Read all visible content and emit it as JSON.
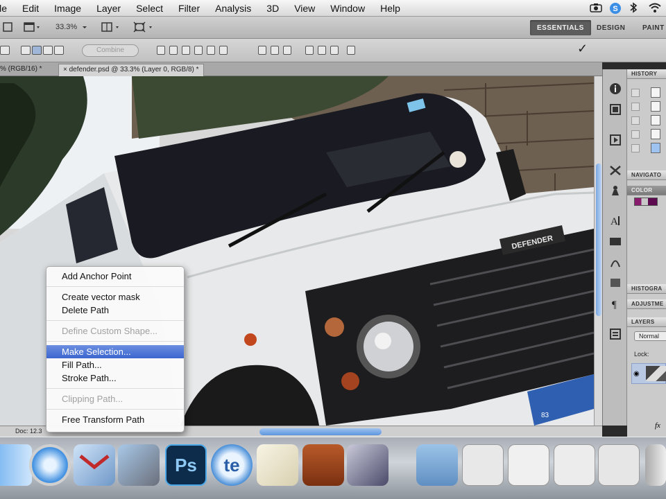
{
  "menubar": {
    "items": [
      "ile",
      "Edit",
      "Image",
      "Layer",
      "Select",
      "Filter",
      "Analysis",
      "3D",
      "View",
      "Window",
      "Help"
    ],
    "status_icons": [
      "camera-icon",
      "skype-icon",
      "bluetooth-icon",
      "wifi-icon"
    ]
  },
  "appbar": {
    "zoom": "33.3%",
    "workspaces": [
      "ESSENTIALS",
      "DESIGN",
      "PAINT"
    ],
    "active_workspace": "ESSENTIALS"
  },
  "optbar": {
    "combine_label": "Combine",
    "confirm_glyph": "✓"
  },
  "tabs": [
    {
      "label": "% (RGB/16) *",
      "active": false
    },
    {
      "label": "defender.psd @ 33.3% (Layer 0, RGB/8) *",
      "active": true
    }
  ],
  "canvas": {
    "badge_text": "DEFENDER",
    "plate_text": "83"
  },
  "context_menu": {
    "items": [
      {
        "label": "Add Anchor Point",
        "enabled": true,
        "selected": false
      },
      {
        "type": "separator"
      },
      {
        "label": "Create vector mask",
        "enabled": true,
        "selected": false
      },
      {
        "label": "Delete Path",
        "enabled": true,
        "selected": false
      },
      {
        "type": "separator"
      },
      {
        "label": "Define Custom Shape...",
        "enabled": false,
        "selected": false
      },
      {
        "type": "separator"
      },
      {
        "label": "Make Selection...",
        "enabled": true,
        "selected": true
      },
      {
        "label": "Fill Path...",
        "enabled": true,
        "selected": false
      },
      {
        "label": "Stroke Path...",
        "enabled": true,
        "selected": false
      },
      {
        "type": "separator"
      },
      {
        "label": "Clipping Path...",
        "enabled": false,
        "selected": false
      },
      {
        "type": "separator"
      },
      {
        "label": "Free Transform Path",
        "enabled": true,
        "selected": false
      }
    ]
  },
  "statusbar": {
    "doc_text": "Doc: 12.3"
  },
  "panels": {
    "history": "HISTORY",
    "navigator": "NAVIGATO",
    "color": "COLOR",
    "histogram": "HISTOGRA",
    "adjustments": "ADJUSTME",
    "layers": "LAYERS",
    "blend_mode": "Normal",
    "lock_label": "Lock:",
    "opacity_glyph": "fx"
  },
  "dock": {
    "items": [
      "finder-icon",
      "safari-icon",
      "mail-icon",
      "iphoto-icon",
      "photoshop-icon",
      "textedit-icon",
      "preview-icon",
      "keynote-icon",
      "imovie-icon",
      "applications-folder-icon",
      "document-icon",
      "document-icon",
      "document-icon",
      "trash-icon"
    ],
    "ps_label": "Ps",
    "te_label": "te"
  }
}
